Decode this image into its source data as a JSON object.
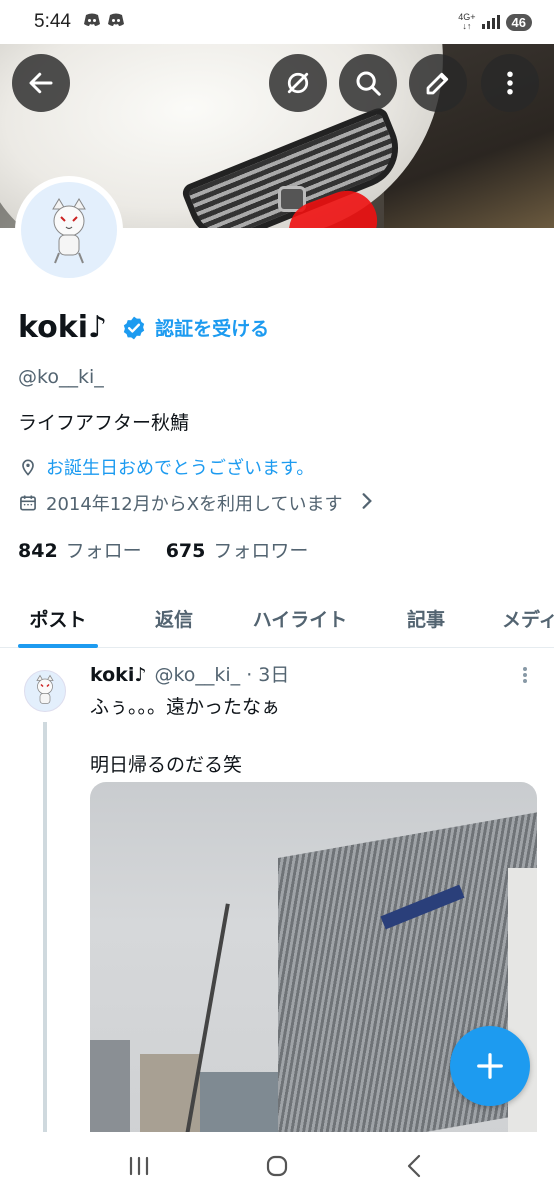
{
  "status_bar": {
    "time": "5:44",
    "network": "4G+",
    "battery": "46"
  },
  "header": {
    "back_icon": "arrow-left-icon",
    "actions": [
      "eye-off-icon",
      "search-icon",
      "edit-icon",
      "more-vertical-icon"
    ]
  },
  "profile": {
    "name": "koki♪",
    "verify_cta": "認証を受ける",
    "handle": "@ko__ki_",
    "bio": "ライフアフター秋鯖",
    "location": "お誕生日おめでとうございます。",
    "joined": "2014年12月からXを利用しています",
    "following_count": "842",
    "following_label": "フォロー",
    "followers_count": "675",
    "followers_label": "フォロワー"
  },
  "tabs": [
    {
      "label": "ポスト",
      "active": true
    },
    {
      "label": "返信",
      "active": false
    },
    {
      "label": "ハイライト",
      "active": false
    },
    {
      "label": "記事",
      "active": false
    },
    {
      "label": "メディア",
      "active": false
    }
  ],
  "post": {
    "name": "koki♪",
    "handle_time": "@ko__ki_ · 3日",
    "text_line1": "ふぅ。。。遠かったなぁ",
    "text_line2": "明日帰るのだる笑"
  },
  "colors": {
    "accent": "#1d9bf0",
    "text": "#0f1419",
    "secondary": "#536471"
  }
}
